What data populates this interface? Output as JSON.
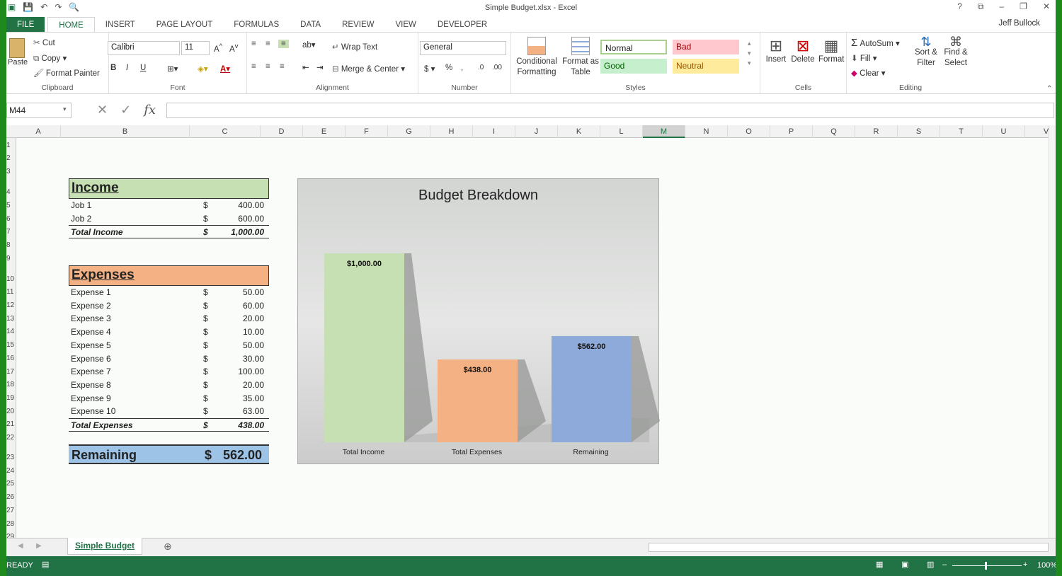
{
  "window": {
    "title": "Simple Budget.xlsx - Excel",
    "user": "Jeff Bullock"
  },
  "tabs": [
    {
      "label": "FILE"
    },
    {
      "label": "HOME"
    },
    {
      "label": "INSERT"
    },
    {
      "label": "PAGE LAYOUT"
    },
    {
      "label": "FORMULAS"
    },
    {
      "label": "DATA"
    },
    {
      "label": "REVIEW"
    },
    {
      "label": "VIEW"
    },
    {
      "label": "DEVELOPER"
    }
  ],
  "ribbon": {
    "clipboard": {
      "paste": "Paste",
      "cut": "Cut",
      "copy": "Copy",
      "format_painter": "Format Painter",
      "label": "Clipboard"
    },
    "font": {
      "name": "Calibri",
      "size": "11",
      "label": "Font",
      "bold": "B",
      "italic": "I",
      "underline": "U"
    },
    "alignment": {
      "wrap": "Wrap Text",
      "merge": "Merge & Center",
      "label": "Alignment"
    },
    "number": {
      "format": "General",
      "label": "Number",
      "currency": "$",
      "percent": "%"
    },
    "styles": {
      "conditional": "Conditional Formatting",
      "format_as_table": "Format as Table",
      "normal": "Normal",
      "bad": "Bad",
      "good": "Good",
      "neutral": "Neutral",
      "label": "Styles"
    },
    "cells": {
      "insert": "Insert",
      "delete": "Delete",
      "format": "Format",
      "label": "Cells"
    },
    "editing": {
      "autosum": "AutoSum",
      "fill": "Fill",
      "clear": "Clear",
      "sort": "Sort & Filter",
      "find": "Find & Select",
      "label": "Editing"
    }
  },
  "formula_bar": {
    "name_box": "M44",
    "fx": "fx",
    "formula": ""
  },
  "columns": [
    "A",
    "B",
    "C",
    "D",
    "E",
    "F",
    "G",
    "H",
    "I",
    "J",
    "K",
    "L",
    "M",
    "N",
    "O",
    "P",
    "Q",
    "R",
    "S",
    "T",
    "U",
    "V"
  ],
  "selected_column": "M",
  "rows": [
    "1",
    "2",
    "3",
    "4",
    "5",
    "6",
    "7",
    "8",
    "9",
    "10",
    "11",
    "12",
    "13",
    "14",
    "15",
    "16",
    "17",
    "18",
    "19",
    "20",
    "21",
    "22",
    "23",
    "24",
    "25",
    "26",
    "27",
    "28",
    "29"
  ],
  "income": {
    "title": "Income",
    "color": "#c6e0b4",
    "items": [
      {
        "label": "Job 1",
        "cur": "$",
        "value": "400.00"
      },
      {
        "label": "Job 2",
        "cur": "$",
        "value": "600.00"
      }
    ],
    "total": {
      "label": "Total Income",
      "cur": "$",
      "value": "1,000.00"
    }
  },
  "expenses": {
    "title": "Expenses",
    "color": "#f4b183",
    "items": [
      {
        "label": "Expense 1",
        "cur": "$",
        "value": "50.00"
      },
      {
        "label": "Expense 2",
        "cur": "$",
        "value": "60.00"
      },
      {
        "label": "Expense 3",
        "cur": "$",
        "value": "20.00"
      },
      {
        "label": "Expense 4",
        "cur": "$",
        "value": "10.00"
      },
      {
        "label": "Expense 5",
        "cur": "$",
        "value": "50.00"
      },
      {
        "label": "Expense 6",
        "cur": "$",
        "value": "30.00"
      },
      {
        "label": "Expense 7",
        "cur": "$",
        "value": "100.00"
      },
      {
        "label": "Expense 8",
        "cur": "$",
        "value": "20.00"
      },
      {
        "label": "Expense 9",
        "cur": "$",
        "value": "35.00"
      },
      {
        "label": "Expense 10",
        "cur": "$",
        "value": "63.00"
      }
    ],
    "total": {
      "label": "Total Expenses",
      "cur": "$",
      "value": "438.00"
    }
  },
  "remaining": {
    "label": "Remaining",
    "cur": "$",
    "value": "562.00"
  },
  "chart_data": {
    "type": "bar",
    "title": "Budget Breakdown",
    "categories": [
      "Total Income",
      "Total Expenses",
      "Remaining"
    ],
    "values": [
      1000,
      438,
      562
    ],
    "data_labels": [
      "$1,000.00",
      "$438.00",
      "$562.00"
    ],
    "colors": [
      "#c6e0b4",
      "#f4b183",
      "#8eaadb"
    ],
    "ylim": [
      0,
      1000
    ],
    "grid": false,
    "xlabel": "",
    "ylabel": ""
  },
  "sheet_tab": "Simple Budget",
  "status": {
    "ready": "READY",
    "zoom": "100%"
  }
}
